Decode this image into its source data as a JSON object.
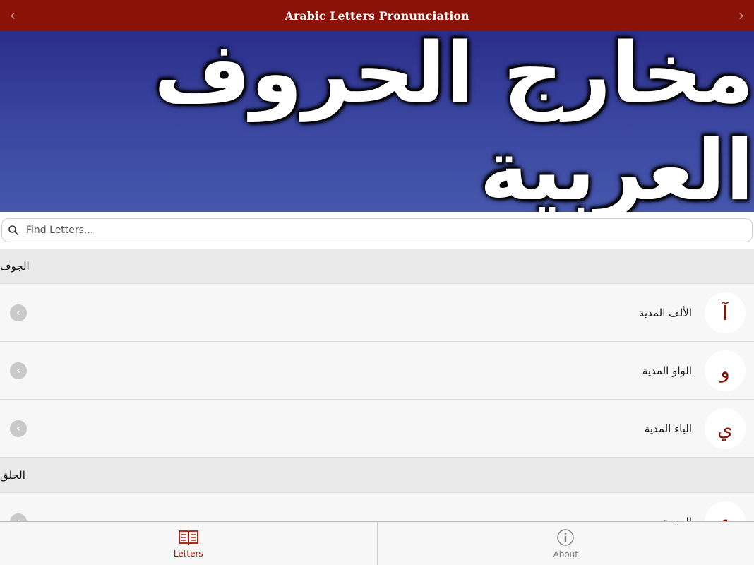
{
  "navbar": {
    "title": "Arabic Letters Pronunciation",
    "back_glyph": "‹",
    "forward_glyph": "›"
  },
  "banner": {
    "text": "مخارج الحروف العربية"
  },
  "search": {
    "placeholder": "Find Letters...",
    "value": ""
  },
  "sections": [
    {
      "title": "الجوف",
      "rows": [
        {
          "letter": "آ",
          "label": "الألف المدية"
        },
        {
          "letter": "و",
          "label": "الواو المدية"
        },
        {
          "letter": "ي",
          "label": "الياء المدية"
        }
      ]
    },
    {
      "title": "الحلق",
      "rows": [
        {
          "letter": "ء",
          "label": "الهمزة"
        }
      ]
    }
  ],
  "tabbar": {
    "tabs": [
      {
        "label": "Letters",
        "icon": "book-icon",
        "active": true,
        "color": "#a01408"
      },
      {
        "label": "About",
        "icon": "info-icon",
        "active": false,
        "color": "#7d7d7d"
      }
    ]
  },
  "colors": {
    "navbar": "#8b1206",
    "accent": "#a01408",
    "banner_top": "#2b2e8a",
    "banner_bottom": "#4657ad"
  }
}
